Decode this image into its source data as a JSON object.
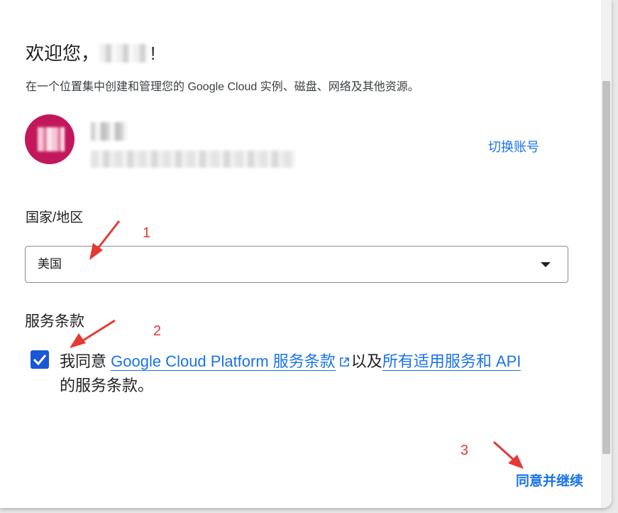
{
  "dialog": {
    "greeting": "欢迎您，",
    "greeting_end": "!",
    "subtitle": "在一个位置集中创建和管理您的 Google Cloud 实例、磁盘、网络及其他资源。"
  },
  "account": {
    "avatar_color": "#c2185b",
    "switch_label": "切换账号"
  },
  "country": {
    "label": "国家/地区",
    "selected": "美国"
  },
  "terms": {
    "label": "服务条款",
    "checked": true,
    "agree_prefix": "我同意 ",
    "link1": "Google Cloud Platform 服务条款",
    "middle": "以及",
    "link2": "所有适用服务和 API",
    "suffix": "的服务条款。"
  },
  "actions": {
    "continue_label": "同意并继续"
  },
  "annotations": {
    "n1": "1",
    "n2": "2",
    "n3": "3",
    "color": "#e53935"
  },
  "colors": {
    "accent": "#1a73e8",
    "checkbox": "#1a56d6"
  }
}
